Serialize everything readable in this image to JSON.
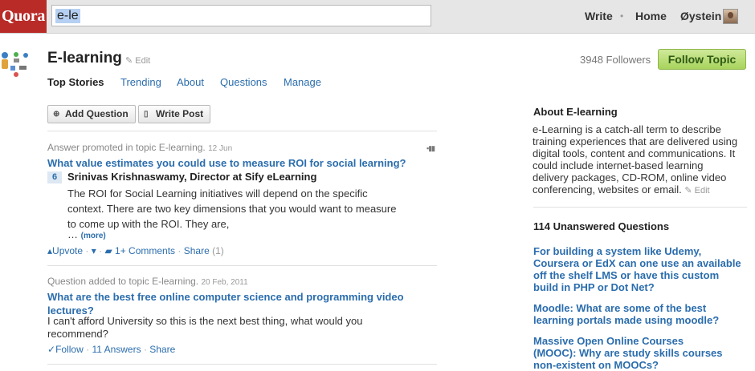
{
  "header": {
    "logo": "Quora",
    "search_value": "e-le",
    "nav": {
      "write": "Write",
      "home": "Home",
      "user": "Øystein"
    }
  },
  "topic": {
    "title": "E-learning",
    "edit": "Edit",
    "followers": "3948 Followers",
    "follow_button": "Follow Topic",
    "tabs": [
      "Top Stories",
      "Trending",
      "About",
      "Questions",
      "Manage"
    ]
  },
  "toolbar": {
    "add_question": "Add Question",
    "write_post": "Write Post"
  },
  "feed": [
    {
      "meta": "Answer promoted in topic E-learning.",
      "date": "12 Jun",
      "question": "What value estimates you could use to measure ROI for social learning?",
      "votes": "6",
      "author": "Srinivas Krishnaswamy, Director at Sify eLearning",
      "text": [
        "The ROI for Social Learning initiatives will depend on the specific",
        "context. There are two key dimensions that you would want to measure",
        "to come up with the ROI. They are,"
      ],
      "ellipsis": "…",
      "more": "(more)",
      "actions": {
        "upvote": "Upvote",
        "comments": "1+ Comments",
        "share": "Share",
        "share_count": "(1)"
      }
    },
    {
      "meta": "Question added to topic E-learning.",
      "date": "20 Feb, 2011",
      "question_lines": [
        "What are the best free online computer science and programming video",
        "lectures?"
      ],
      "text": [
        "I can't afford University so this is the next best thing, what would you",
        "recommend?"
      ],
      "actions": {
        "follow": "Follow",
        "answers": "11 Answers",
        "share": "Share"
      }
    }
  ],
  "sidebar": {
    "about_heading": "About E-learning",
    "about_lines": [
      "e-Learning is a catch-all term to describe",
      "training experiences that are delivered using",
      "digital tools, content and communications. It",
      "could include internet-based learning",
      "delivery packages, CD-ROM, online video",
      "conferencing, websites or email."
    ],
    "about_edit": "Edit",
    "unanswered_heading": "114 Unanswered Questions",
    "questions": [
      [
        "For building a system like Udemy,",
        "Coursera or EdX can one use an available",
        "off the shelf LMS or have this custom",
        "build in PHP or Dot Net?"
      ],
      [
        "Moodle: What are some of the best",
        "learning portals made using moodle?"
      ],
      [
        "Massive Open Online Courses",
        "(MOOC): Why are study skills courses",
        "non-existent on MOOCs?"
      ]
    ]
  }
}
